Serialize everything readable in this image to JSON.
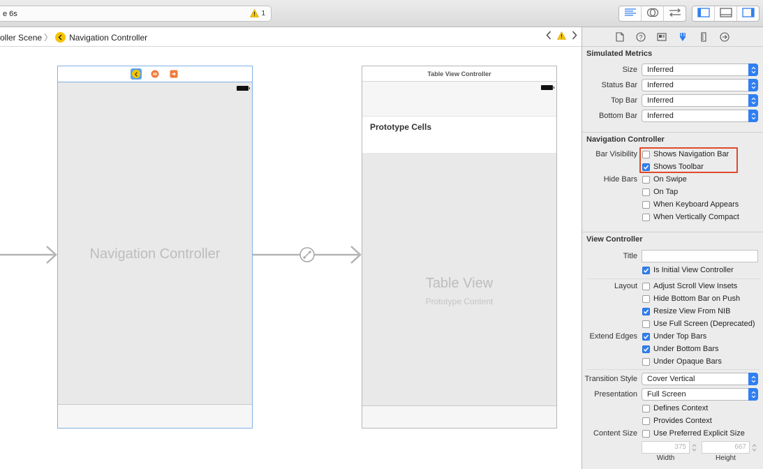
{
  "toolbar": {
    "activity_title": "e 6s",
    "warning_count": "1"
  },
  "jumpbar": {
    "crumb_scene": "oller Scene",
    "crumb_controller": "Navigation Controller"
  },
  "canvas": {
    "nav_controller_label": "Navigation Controller",
    "table_vc_title": "Table View Controller",
    "prototype_cells_label": "Prototype Cells",
    "table_view_label": "Table View",
    "prototype_content_label": "Prototype Content"
  },
  "inspector": {
    "simulated_metrics": {
      "title": "Simulated Metrics",
      "rows": [
        {
          "label": "Size",
          "value": "Inferred"
        },
        {
          "label": "Status Bar",
          "value": "Inferred"
        },
        {
          "label": "Top Bar",
          "value": "Inferred"
        },
        {
          "label": "Bottom Bar",
          "value": "Inferred"
        }
      ]
    },
    "navigation_controller": {
      "title": "Navigation Controller",
      "bar_visibility_label": "Bar Visibility",
      "shows_navigation_bar": {
        "label": "Shows Navigation Bar",
        "checked": false
      },
      "shows_toolbar": {
        "label": "Shows Toolbar",
        "checked": true
      },
      "hide_bars_label": "Hide Bars",
      "on_swipe": {
        "label": "On Swipe",
        "checked": false
      },
      "on_tap": {
        "label": "On Tap",
        "checked": false
      },
      "when_keyboard_appears": {
        "label": "When Keyboard Appears",
        "checked": false
      },
      "when_vertically_compact": {
        "label": "When Vertically Compact",
        "checked": false
      }
    },
    "view_controller": {
      "title": "View Controller",
      "title_label": "Title",
      "title_value": "",
      "is_initial": {
        "label": "Is Initial View Controller",
        "checked": true
      },
      "layout_label": "Layout",
      "adjust_scroll": {
        "label": "Adjust Scroll View Insets",
        "checked": false
      },
      "hide_bottom_bar": {
        "label": "Hide Bottom Bar on Push",
        "checked": false
      },
      "resize_from_nib": {
        "label": "Resize View From NIB",
        "checked": true
      },
      "use_full_screen": {
        "label": "Use Full Screen (Deprecated)",
        "checked": false
      },
      "extend_edges_label": "Extend Edges",
      "under_top_bars": {
        "label": "Under Top Bars",
        "checked": true
      },
      "under_bottom_bars": {
        "label": "Under Bottom Bars",
        "checked": true
      },
      "under_opaque_bars": {
        "label": "Under Opaque Bars",
        "checked": false
      },
      "transition_style_label": "Transition Style",
      "transition_style_value": "Cover Vertical",
      "presentation_label": "Presentation",
      "presentation_value": "Full Screen",
      "defines_context": {
        "label": "Defines Context",
        "checked": false
      },
      "provides_context": {
        "label": "Provides Context",
        "checked": false
      },
      "content_size_label": "Content Size",
      "use_preferred_size": {
        "label": "Use Preferred Explicit Size",
        "checked": false
      },
      "width_value": "375",
      "height_value": "667",
      "width_caption": "Width",
      "height_caption": "Height"
    }
  },
  "colors": {
    "accent": "#2f7ff0",
    "highlight": "#e04a2a",
    "warning": "#f5c400"
  }
}
